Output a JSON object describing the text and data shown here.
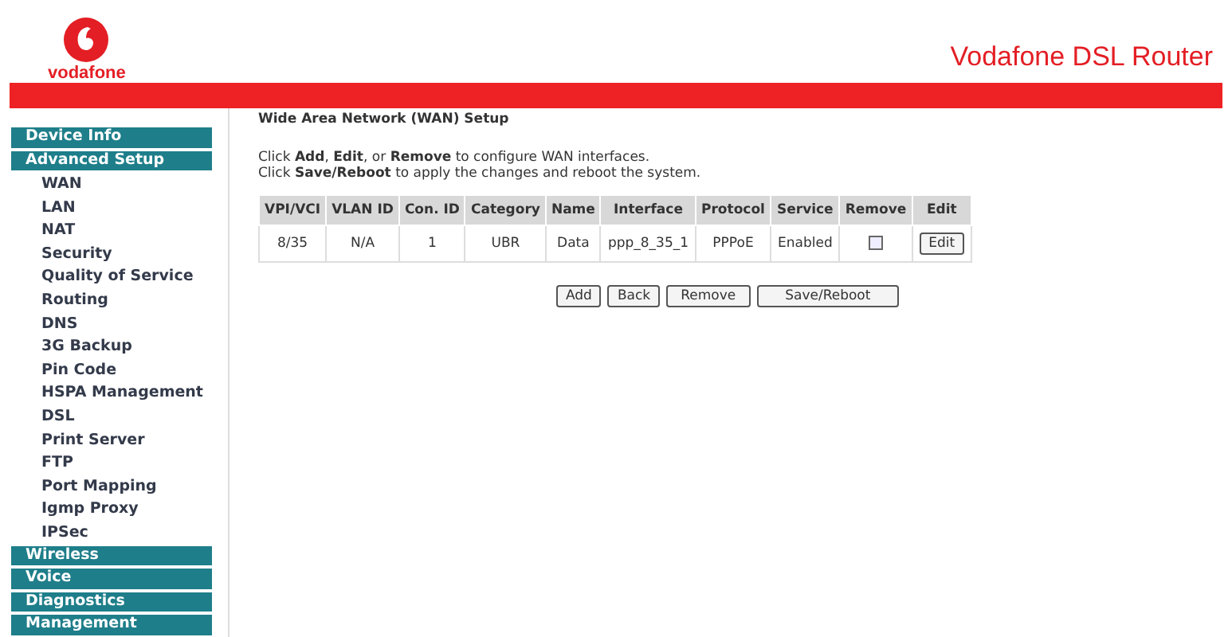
{
  "header": {
    "brand": "vodafone",
    "title": "Vodafone DSL Router"
  },
  "sidebar": {
    "items": [
      {
        "label": "Device Info"
      },
      {
        "label": "Advanced Setup",
        "children": [
          {
            "label": "WAN"
          },
          {
            "label": "LAN"
          },
          {
            "label": "NAT"
          },
          {
            "label": "Security"
          },
          {
            "label": "Quality of Service"
          },
          {
            "label": "Routing"
          },
          {
            "label": "DNS"
          },
          {
            "label": "3G Backup"
          },
          {
            "label": "Pin Code"
          },
          {
            "label": "HSPA Management"
          },
          {
            "label": "DSL"
          },
          {
            "label": "Print Server"
          },
          {
            "label": "FTP"
          },
          {
            "label": "Port Mapping"
          },
          {
            "label": "Igmp Proxy"
          },
          {
            "label": "IPSec"
          }
        ]
      },
      {
        "label": "Wireless"
      },
      {
        "label": "Voice"
      },
      {
        "label": "Diagnostics"
      },
      {
        "label": "Management"
      }
    ]
  },
  "main": {
    "heading": "Wide Area Network (WAN) Setup",
    "instructions": [
      "Click **Add**, **Edit**, or **Remove** to configure WAN interfaces.",
      "Click **Save/Reboot** to apply the changes and reboot the system."
    ],
    "table": {
      "columns": [
        "VPI/VCI",
        "VLAN ID",
        "Con. ID",
        "Category",
        "Name",
        "Interface",
        "Protocol",
        "Service",
        "Remove",
        "Edit"
      ],
      "rows": [
        {
          "cells": [
            "8/35",
            "N/A",
            "1",
            "UBR",
            "Data",
            "ppp_8_35_1",
            "PPPoE",
            "Enabled"
          ],
          "remove_checked": false,
          "edit_button": "Edit"
        }
      ]
    },
    "buttons": [
      "Add",
      "Back",
      "Remove",
      "Save/Reboot"
    ]
  }
}
